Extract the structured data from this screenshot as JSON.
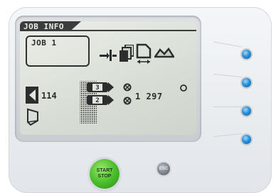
{
  "screen": {
    "header_title": "JOB INFO",
    "job_name": "JOB 1",
    "side_count": "114",
    "main_count": "1 297",
    "pocket_labels": [
      "3",
      "2"
    ]
  },
  "controls": {
    "start_label": "START",
    "stop_label": "STOP",
    "esc_label": "ESC"
  },
  "leds": [
    {
      "name": "led-1",
      "color": "#2a90d8"
    },
    {
      "name": "led-2",
      "color": "#2a90d8"
    },
    {
      "name": "led-3",
      "color": "#2a90d8"
    },
    {
      "name": "led-4",
      "color": "#2a90d8"
    }
  ],
  "icons": [
    "cutter-icon",
    "stack-icon",
    "fold-length-icon",
    "crease-icon",
    "back-arrow-icon",
    "tray-icon",
    "feeder-icon",
    "sensor-icon"
  ],
  "colors": {
    "lcd_background": "#d8ddd6",
    "lcd_text": "#2b2e2d",
    "start_button": "#4bbf2c",
    "led_blue": "#2a90d8"
  }
}
